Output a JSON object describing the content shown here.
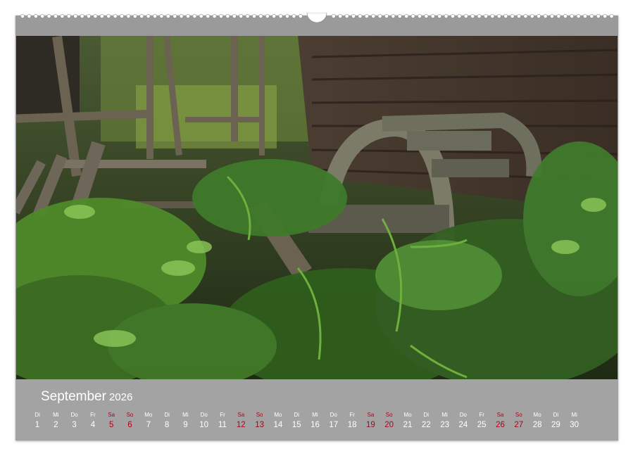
{
  "calendar": {
    "month": "September",
    "year": "2026",
    "days": [
      {
        "wd": "Di",
        "d": "1",
        "we": false
      },
      {
        "wd": "Mi",
        "d": "2",
        "we": false
      },
      {
        "wd": "Do",
        "d": "3",
        "we": false
      },
      {
        "wd": "Fr",
        "d": "4",
        "we": false
      },
      {
        "wd": "Sa",
        "d": "5",
        "we": true
      },
      {
        "wd": "So",
        "d": "6",
        "we": true
      },
      {
        "wd": "Mo",
        "d": "7",
        "we": false
      },
      {
        "wd": "Di",
        "d": "8",
        "we": false
      },
      {
        "wd": "Mi",
        "d": "9",
        "we": false
      },
      {
        "wd": "Do",
        "d": "10",
        "we": false
      },
      {
        "wd": "Fr",
        "d": "11",
        "we": false
      },
      {
        "wd": "Sa",
        "d": "12",
        "we": true
      },
      {
        "wd": "So",
        "d": "13",
        "we": true
      },
      {
        "wd": "Mo",
        "d": "14",
        "we": false
      },
      {
        "wd": "Di",
        "d": "15",
        "we": false
      },
      {
        "wd": "Mi",
        "d": "16",
        "we": false
      },
      {
        "wd": "Do",
        "d": "17",
        "we": false
      },
      {
        "wd": "Fr",
        "d": "18",
        "we": false
      },
      {
        "wd": "Sa",
        "d": "19",
        "we": true
      },
      {
        "wd": "So",
        "d": "20",
        "we": true
      },
      {
        "wd": "Mo",
        "d": "21",
        "we": false
      },
      {
        "wd": "Di",
        "d": "22",
        "we": false
      },
      {
        "wd": "Mi",
        "d": "23",
        "we": false
      },
      {
        "wd": "Do",
        "d": "24",
        "we": false
      },
      {
        "wd": "Fr",
        "d": "25",
        "we": false
      },
      {
        "wd": "Sa",
        "d": "26",
        "we": true
      },
      {
        "wd": "So",
        "d": "27",
        "we": true
      },
      {
        "wd": "Mo",
        "d": "28",
        "we": false
      },
      {
        "wd": "Di",
        "d": "29",
        "we": false
      },
      {
        "wd": "Mi",
        "d": "30",
        "we": false
      }
    ]
  },
  "colors": {
    "weekend": "#b3001b",
    "bar": "#a3a3a3",
    "text": "#ffffff"
  }
}
